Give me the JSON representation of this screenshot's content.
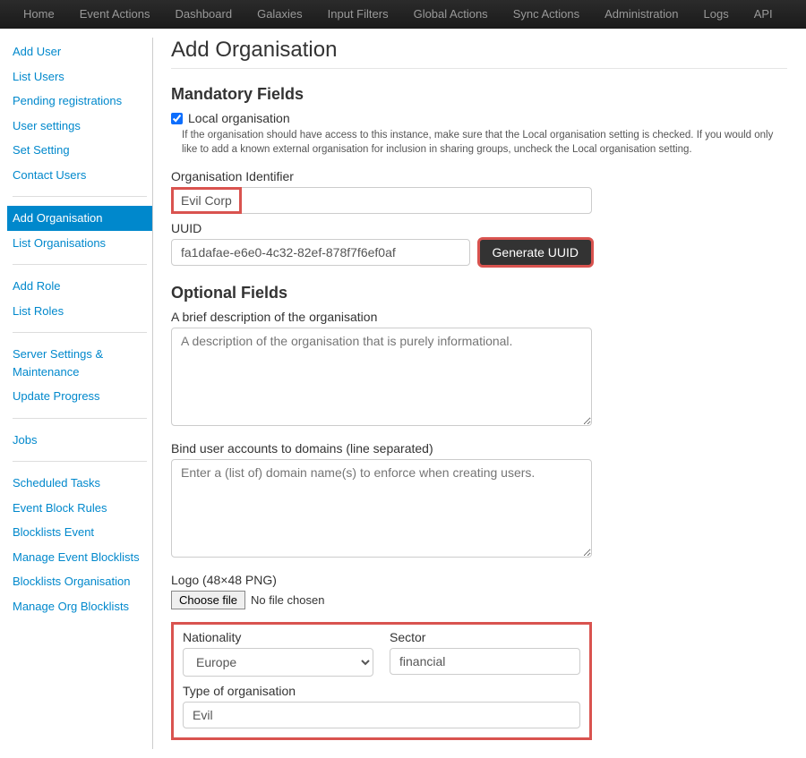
{
  "topnav": [
    "Home",
    "Event Actions",
    "Dashboard",
    "Galaxies",
    "Input Filters",
    "Global Actions",
    "Sync Actions",
    "Administration",
    "Logs",
    "API"
  ],
  "sidebar": {
    "group1": [
      "Add User",
      "List Users",
      "Pending registrations",
      "User settings",
      "Set Setting",
      "Contact Users"
    ],
    "group2": [
      "Add Organisation",
      "List Organisations"
    ],
    "active": "Add Organisation",
    "group3": [
      "Add Role",
      "List Roles"
    ],
    "group4": [
      "Server Settings & Maintenance",
      "Update Progress"
    ],
    "group5": [
      "Jobs"
    ],
    "group6": [
      "Scheduled Tasks",
      "Event Block Rules",
      "Blocklists Event",
      "Manage Event Blocklists",
      "Blocklists Organisation",
      "Manage Org Blocklists"
    ]
  },
  "page": {
    "title": "Add Organisation",
    "mandatory_heading": "Mandatory Fields",
    "local_org_label": "Local organisation",
    "local_org_checked": true,
    "help_text": "If the organisation should have access to this instance, make sure that the Local organisation setting is checked. If you would only like to add a known external organisation for inclusion in sharing groups, uncheck the Local organisation setting.",
    "org_id_label": "Organisation Identifier",
    "org_id_value": "Evil Corp",
    "uuid_label": "UUID",
    "uuid_value": "fa1dafae-e6e0-4c32-82ef-878f7f6ef0af",
    "generate_uuid_btn": "Generate UUID",
    "optional_heading": "Optional Fields",
    "desc_label": "A brief description of the organisation",
    "desc_placeholder": "A description of the organisation that is purely informational.",
    "bind_label": "Bind user accounts to domains (line separated)",
    "bind_placeholder": "Enter a (list of) domain name(s) to enforce when creating users.",
    "logo_label": "Logo (48×48 PNG)",
    "choose_file": "Choose file",
    "no_file": "No file chosen",
    "nationality_label": "Nationality",
    "nationality_value": "Europe",
    "sector_label": "Sector",
    "sector_value": "financial",
    "type_label": "Type of organisation",
    "type_value": "Evil"
  }
}
